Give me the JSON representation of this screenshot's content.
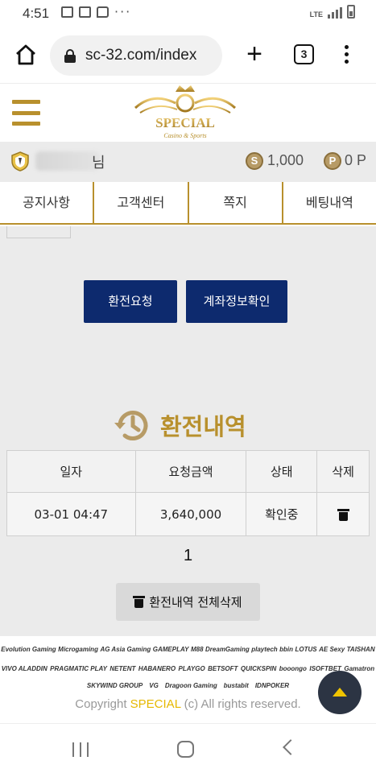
{
  "status_bar": {
    "time": "4:51",
    "network": "LTE",
    "more": "···"
  },
  "browser": {
    "url": "sc-32.com/index",
    "tab_count": "3"
  },
  "site": {
    "logo_text": "SPECIAL",
    "logo_tagline": "Casino & Sports"
  },
  "user": {
    "name_suffix": "님",
    "money_icon": "S",
    "money": "1,000",
    "point_icon": "P",
    "point": "0 P"
  },
  "nav_tabs": [
    "공지사항",
    "고객센터",
    "쪽지",
    "베팅내역"
  ],
  "actions": {
    "request": "환전요청",
    "account": "계좌정보확인"
  },
  "history": {
    "title": "환전내역",
    "columns": [
      "일자",
      "요청금액",
      "상태",
      "삭제"
    ],
    "rows": [
      {
        "date": "03-01 04:47",
        "amount": "3,640,000",
        "status": "확인중"
      }
    ],
    "page": "1",
    "delete_all": "환전내역 전체삭제"
  },
  "footer": {
    "providers_row1": [
      "Evolution Gaming",
      "Microgaming",
      "AG Asia Gaming",
      "GAMEPLAY",
      "M88",
      "DreamGaming",
      "playtech",
      "bbin",
      "LOTUS",
      "AE Sexy",
      "TAISHAN"
    ],
    "providers_row2": [
      "VIVO ALADDIN",
      "PRAGMATIC PLAY",
      "NETENT",
      "HABANERO",
      "PLAYGO",
      "BETSOFT",
      "QUICKSPIN",
      "booongo",
      "ISOFTBET",
      "Gamatron"
    ],
    "providers_row3": [
      "SKYWIND GROUP",
      "VG",
      "Dragoon Gaming",
      "bustabit",
      "IDNPOKER"
    ],
    "copyright_prefix": "Copyright",
    "copyright_brand": "SPECIAL",
    "copyright_suffix": "(c) All rights reserved."
  },
  "colors": {
    "gold": "#b8902d",
    "navy": "#0d2a6e",
    "yellow": "#e6b800",
    "dark": "#2c3443"
  }
}
